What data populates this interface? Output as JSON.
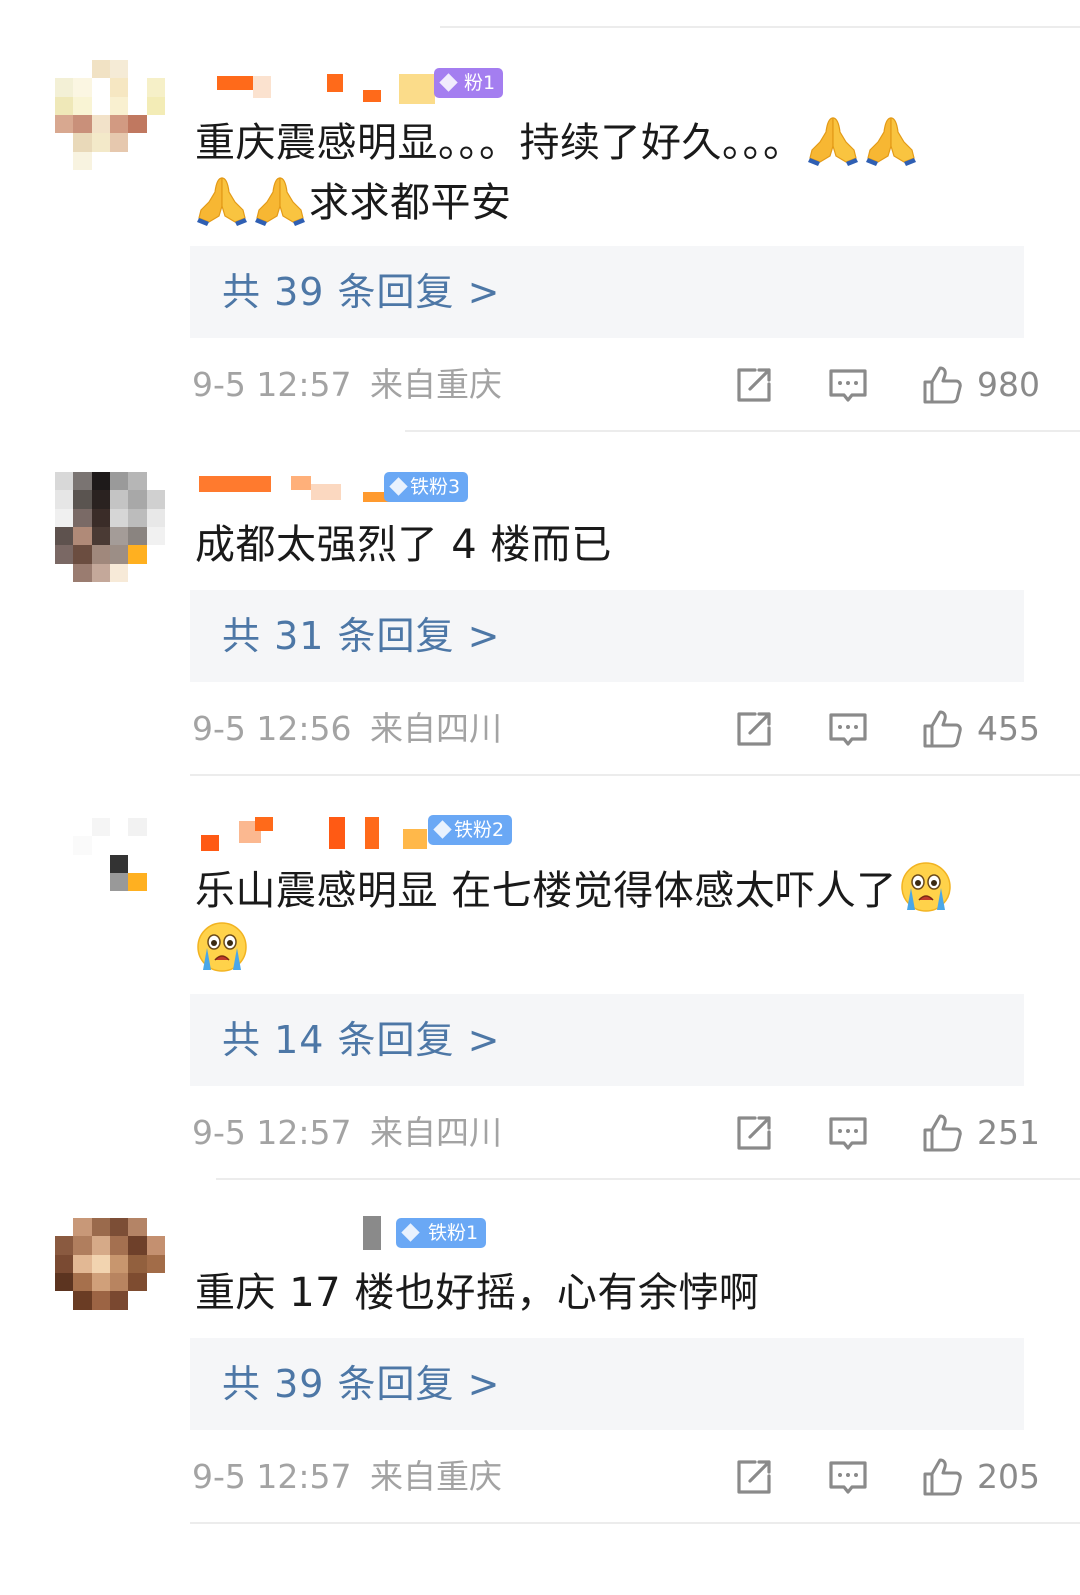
{
  "comments": [
    {
      "badge": "粉1",
      "text_before_emoji": "重庆震感明显。。。持续了好久。。。",
      "text_after_emoji": "求求都平安",
      "emoji": "folded-hands",
      "replies": "共 39 条回复 >",
      "time": "9-5 12:57",
      "location": "来自重庆",
      "likes": "980"
    },
    {
      "badge": "铁粉3",
      "text": "成都太强烈了 4 楼而已",
      "replies": "共 31 条回复 >",
      "time": "9-5 12:56",
      "location": "来自四川",
      "likes": "455"
    },
    {
      "badge": "铁粉2",
      "text": "乐山震感明显 在七楼觉得体感太吓人了",
      "emoji": "crying-face",
      "replies": "共 14 条回复 >",
      "time": "9-5 12:57",
      "location": "来自四川",
      "likes": "251"
    },
    {
      "badge": "铁粉1",
      "text": "重庆 17 楼也好摇，心有余悖啊",
      "replies": "共 39 条回复 >",
      "time": "9-5 12:57",
      "location": "来自重庆",
      "likes": "205"
    }
  ],
  "colors": {
    "reply_link": "#4d77a6",
    "meta_text": "#a3a3a3",
    "badge_purple": "#a47ef0",
    "badge_blue": "#6aa8f5",
    "reply_bg": "#f5f6f8"
  },
  "icons": [
    "share-icon",
    "comment-icon",
    "like-icon",
    "folded-hands-emoji",
    "crying-face-emoji",
    "diamond-icon"
  ]
}
